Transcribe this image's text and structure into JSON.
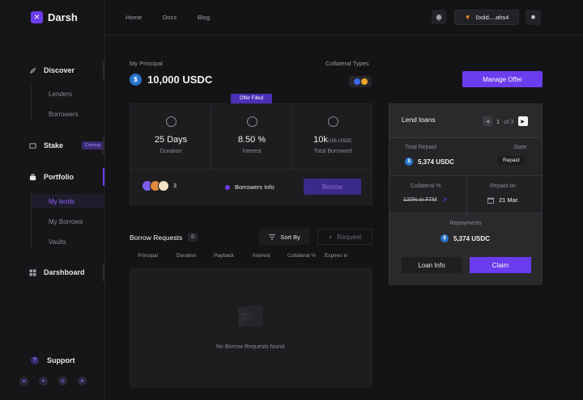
{
  "app": {
    "name": "Darsh"
  },
  "sidebar": {
    "discover": {
      "label": "Discover",
      "items": [
        {
          "label": "Lenders"
        },
        {
          "label": "Borrowers"
        }
      ]
    },
    "stake": {
      "label": "Stake",
      "badge": "Coming"
    },
    "portfolio": {
      "label": "Portfolio",
      "items": [
        {
          "label": "My lends"
        },
        {
          "label": "My Borrows"
        },
        {
          "label": "Vaults"
        }
      ]
    },
    "dashboard": {
      "label": "Darshboard"
    },
    "support": {
      "label": "Support"
    },
    "socials": [
      "medium-icon",
      "twitter-icon",
      "discord-icon",
      "telegram-icon"
    ]
  },
  "topbar": {
    "links": [
      {
        "label": "Home"
      },
      {
        "label": "Docs"
      },
      {
        "label": "Blog"
      }
    ],
    "wallet": {
      "address": "0xdd....ahs4"
    }
  },
  "principal": {
    "label": "My Principal",
    "value": "10,000 USDC",
    "token_symbol": "$"
  },
  "collateral": {
    "label": "Collateral Types"
  },
  "manage_offer": {
    "label": "Manage Offer"
  },
  "offer": {
    "badge": "Offer Filled",
    "stats": [
      {
        "value": "25 Days",
        "label": "Duration"
      },
      {
        "value": "8.50 %",
        "label": "Interest"
      },
      {
        "value": "10k",
        "sub": "/10k USDC",
        "label": "Total Borrowed"
      }
    ],
    "borrower_count": "3",
    "borrowers_info": "Borrowers Info",
    "borrow_label": "Borrow"
  },
  "borrow_requests": {
    "title": "Borrow Requests",
    "count": "0",
    "sort_label": "Sort By",
    "request_label": "Request",
    "columns": [
      "Principal",
      "Duration",
      "Payback",
      "Interest",
      "Collateral %",
      "Expires in"
    ],
    "empty_text": "No Borrow Requests found."
  },
  "lend_loans": {
    "title": "Lend loans",
    "pager": {
      "current": "1",
      "of": "of 3"
    },
    "total_repaid": {
      "label": "Total Repaid",
      "value": "5,374 USDC"
    },
    "state": {
      "label": "State",
      "value": "Repaid"
    },
    "collateral": {
      "label": "Collateral %",
      "value": "120% in FTM"
    },
    "repaid_on": {
      "label": "Repaid on",
      "value": "21 Mar."
    },
    "repayments": {
      "label": "Repayments",
      "value": "5,374 USDC"
    },
    "loan_info_label": "Loan Info",
    "claim_label": "Claim"
  },
  "colors": {
    "accent": "#6b3cf0",
    "usdc": "#2775ca",
    "background": "#141416"
  }
}
